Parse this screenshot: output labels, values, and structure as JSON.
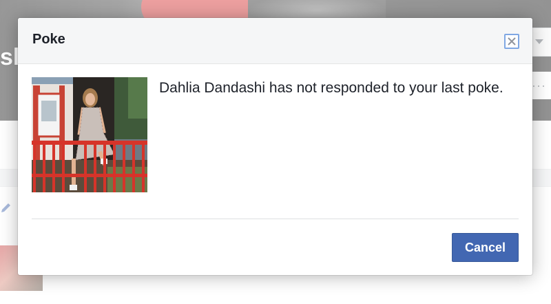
{
  "background": {
    "profile_name_fragment": "sl"
  },
  "dialog": {
    "title": "Poke",
    "close_icon": "close-icon",
    "message": "Dahlia Dandashi has not responded to your last poke.",
    "cancel_label": "Cancel"
  },
  "colors": {
    "primary_button": "#4267b2",
    "header_bg": "#f5f6f7",
    "close_focus_ring": "#7fa7e3",
    "text": "#1d2129"
  }
}
